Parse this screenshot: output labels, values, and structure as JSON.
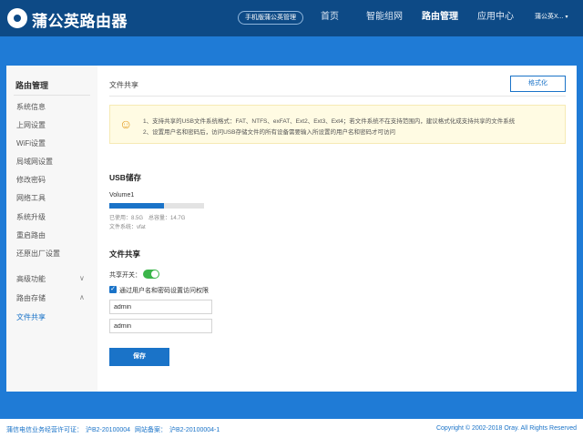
{
  "header": {
    "brand": "蒲公英路由器",
    "mobile_link": "手机版蒲公英管理",
    "nav": [
      {
        "label": "首页"
      },
      {
        "label": "智能组网"
      },
      {
        "label": "路由管理"
      },
      {
        "label": "应用中心"
      }
    ],
    "user": "蒲公英X...",
    "user_caret": "▾"
  },
  "sidebar": {
    "title": "路由管理",
    "items": [
      {
        "label": "系统信息"
      },
      {
        "label": "上网设置"
      },
      {
        "label": "WiFi设置"
      },
      {
        "label": "局域网设置"
      },
      {
        "label": "修改密码"
      },
      {
        "label": "网络工具"
      },
      {
        "label": "系统升级"
      },
      {
        "label": "重启路由"
      },
      {
        "label": "还原出厂设置"
      }
    ],
    "groups": [
      {
        "label": "高级功能",
        "chevron": "∨"
      },
      {
        "label": "路由存储",
        "chevron": "∧"
      }
    ],
    "active_sub": "文件共享"
  },
  "main": {
    "heading": "文件共享",
    "format_button": "格式化",
    "notice": {
      "icon": "smiley-icon",
      "line1": "1、支持共享的USB文件系统格式：FAT、NTFS、exFAT、Ext2、Ext3、Ext4；若文件系统不在支持范围内，建议格式化成支持共享的文件系统",
      "line2": "2、设置用户名和密码后，访问USB存储文件的所有设备需要输入所设置的用户名和密码才可访问"
    },
    "usb": {
      "title": "USB储存",
      "volume": "Volume1",
      "used_fraction": 0.58,
      "used": "已使用：8.5G",
      "total": "总容量：14.7G",
      "filesystem": "文件系统：vfat"
    },
    "share": {
      "title": "文件共享",
      "switch_label": "共享开关：",
      "switch_on": true,
      "checkbox_label": "通过用户名和密码设置访问权限",
      "checkbox_checked": true,
      "username": "admin",
      "password": "admin",
      "save": "保存"
    }
  },
  "footer": {
    "license": "蒲信电信业务经营许可证：",
    "license_no": "沪B2-20100004",
    "icp": "网站备案：",
    "icp_no": "沪B2-20100004-1",
    "copyright": "Copyright © 2002-2018 Oray. All Rights Reserved"
  },
  "colors": {
    "topbar": "#0d4a86",
    "background": "#1f7bd6",
    "accent": "#1a73c8",
    "toggle_on": "#3bb54a",
    "notice_bg": "#fffbe3"
  }
}
